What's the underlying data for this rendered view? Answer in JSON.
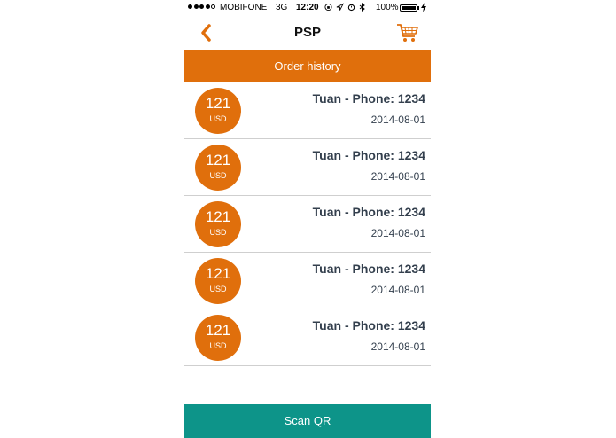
{
  "status_bar": {
    "carrier": "MOBIFONE",
    "network": "3G",
    "time": "12:20",
    "battery": "100%",
    "icons": [
      "lock-rotation-icon",
      "location-icon",
      "alarm-icon",
      "bluetooth-icon"
    ]
  },
  "nav": {
    "title": "PSP",
    "back_icon": "chevron-left-icon",
    "cart_icon": "shopping-cart-icon"
  },
  "section_header": "Order history",
  "orders": [
    {
      "amount": "121",
      "currency": "USD",
      "name": "Tuan - Phone: 1234",
      "date": "2014-08-01"
    },
    {
      "amount": "121",
      "currency": "USD",
      "name": "Tuan - Phone: 1234",
      "date": "2014-08-01"
    },
    {
      "amount": "121",
      "currency": "USD",
      "name": "Tuan - Phone: 1234",
      "date": "2014-08-01"
    },
    {
      "amount": "121",
      "currency": "USD",
      "name": "Tuan - Phone: 1234",
      "date": "2014-08-01"
    },
    {
      "amount": "121",
      "currency": "USD",
      "name": "Tuan - Phone: 1234",
      "date": "2014-08-01"
    }
  ],
  "scan_button": "Scan QR",
  "colors": {
    "accent": "#e06f0c",
    "button": "#0d9489",
    "text": "#333f4d",
    "divider": "#cfcfcf"
  }
}
